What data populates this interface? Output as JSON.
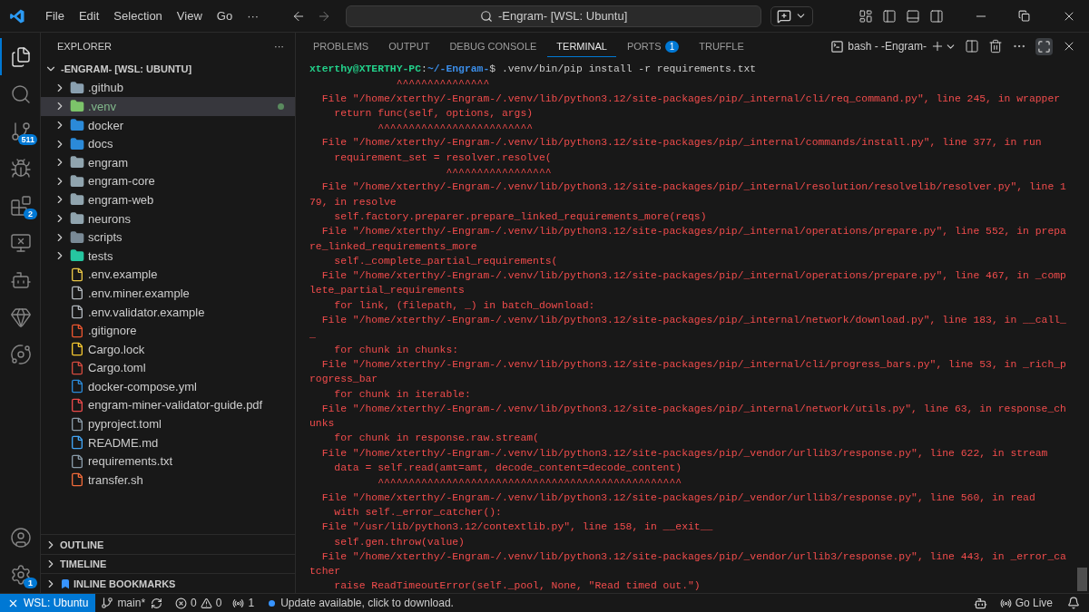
{
  "menu": [
    "File",
    "Edit",
    "Selection",
    "View",
    "Go",
    "···"
  ],
  "command_center": {
    "text": "-Engram- [WSL: Ubuntu]"
  },
  "activity_bar": {
    "badges": [
      "511",
      "2",
      "1"
    ]
  },
  "explorer": {
    "title": "EXPLORER",
    "more": "···",
    "root": "-ENGRAM- [WSL: UBUNTU]",
    "items": [
      {
        "label": ".github",
        "kind": "folder",
        "color": "#8aa0b0",
        "selected": false,
        "ignored": false
      },
      {
        "label": ".venv",
        "kind": "folder",
        "color": "#7cc46a",
        "selected": true,
        "ignored": true
      },
      {
        "label": "docker",
        "kind": "folder",
        "color": "#2b8ad8",
        "selected": false,
        "ignored": false
      },
      {
        "label": "docs",
        "kind": "folder",
        "color": "#2b8ad8",
        "selected": false,
        "ignored": false
      },
      {
        "label": "engram",
        "kind": "folder",
        "color": "#90a4ae",
        "selected": false,
        "ignored": false
      },
      {
        "label": "engram-core",
        "kind": "folder",
        "color": "#90a4ae",
        "selected": false,
        "ignored": false
      },
      {
        "label": "engram-web",
        "kind": "folder",
        "color": "#90a4ae",
        "selected": false,
        "ignored": false
      },
      {
        "label": "neurons",
        "kind": "folder",
        "color": "#90a4ae",
        "selected": false,
        "ignored": false
      },
      {
        "label": "scripts",
        "kind": "folder",
        "color": "#7a8a96",
        "selected": false,
        "ignored": false
      },
      {
        "label": "tests",
        "kind": "folder",
        "color": "#26c6a0",
        "selected": false,
        "ignored": false
      },
      {
        "label": ".env.example",
        "kind": "file",
        "color": "#e8c547",
        "selected": false,
        "ignored": false
      },
      {
        "label": ".env.miner.example",
        "kind": "file",
        "color": "#b0b6bc",
        "selected": false,
        "ignored": false
      },
      {
        "label": ".env.validator.example",
        "kind": "file",
        "color": "#b0b6bc",
        "selected": false,
        "ignored": false
      },
      {
        "label": ".gitignore",
        "kind": "file",
        "color": "#e8552f",
        "selected": false,
        "ignored": false
      },
      {
        "label": "Cargo.lock",
        "kind": "file",
        "color": "#f2c530",
        "selected": false,
        "ignored": false
      },
      {
        "label": "Cargo.toml",
        "kind": "file",
        "color": "#d24a3e",
        "selected": false,
        "ignored": false
      },
      {
        "label": "docker-compose.yml",
        "kind": "file",
        "color": "#2b8ad8",
        "selected": false,
        "ignored": false
      },
      {
        "label": "engram-miner-validator-guide.pdf",
        "kind": "file",
        "color": "#e84a4a",
        "selected": false,
        "ignored": false
      },
      {
        "label": "pyproject.toml",
        "kind": "file",
        "color": "#8a9ba8",
        "selected": false,
        "ignored": false
      },
      {
        "label": "README.md",
        "kind": "file",
        "color": "#42a5f5",
        "selected": false,
        "ignored": false
      },
      {
        "label": "requirements.txt",
        "kind": "file",
        "color": "#8a9ba8",
        "selected": false,
        "ignored": false
      },
      {
        "label": "transfer.sh",
        "kind": "file",
        "color": "#ee6a3a",
        "selected": false,
        "ignored": false
      }
    ],
    "sections": [
      "OUTLINE",
      "TIMELINE",
      "INLINE BOOKMARKS"
    ]
  },
  "panel": {
    "tabs": [
      {
        "label": "PROBLEMS",
        "selected": false
      },
      {
        "label": "OUTPUT",
        "selected": false
      },
      {
        "label": "DEBUG CONSOLE",
        "selected": false
      },
      {
        "label": "TERMINAL",
        "selected": true
      },
      {
        "label": "PORTS",
        "selected": false,
        "badge": "1"
      },
      {
        "label": "TRUFFLE",
        "selected": false
      }
    ],
    "terminal_name": "bash - -Engram-"
  },
  "terminal": {
    "prompt": {
      "user": "xterthy@XTERTHY-PC",
      "sep": ":",
      "path": "~/-Engram-",
      "symbol": "$",
      "command": " .venv/bin/pip install -r requirements.txt"
    },
    "lines": [
      "              ^^^^^^^^^^^^^^^",
      "  File \"/home/xterthy/-Engram-/.venv/lib/python3.12/site-packages/pip/_internal/cli/req_command.py\", line 245, in wrapper",
      "    return func(self, options, args)",
      "           ^^^^^^^^^^^^^^^^^^^^^^^^^",
      "  File \"/home/xterthy/-Engram-/.venv/lib/python3.12/site-packages/pip/_internal/commands/install.py\", line 377, in run",
      "    requirement_set = resolver.resolve(",
      "                      ^^^^^^^^^^^^^^^^^",
      "  File \"/home/xterthy/-Engram-/.venv/lib/python3.12/site-packages/pip/_internal/resolution/resolvelib/resolver.py\", line 1",
      "79, in resolve",
      "    self.factory.preparer.prepare_linked_requirements_more(reqs)",
      "  File \"/home/xterthy/-Engram-/.venv/lib/python3.12/site-packages/pip/_internal/operations/prepare.py\", line 552, in prepa",
      "re_linked_requirements_more",
      "    self._complete_partial_requirements(",
      "  File \"/home/xterthy/-Engram-/.venv/lib/python3.12/site-packages/pip/_internal/operations/prepare.py\", line 467, in _comp",
      "lete_partial_requirements",
      "    for link, (filepath, _) in batch_download:",
      "  File \"/home/xterthy/-Engram-/.venv/lib/python3.12/site-packages/pip/_internal/network/download.py\", line 183, in __call_",
      "_",
      "    for chunk in chunks:",
      "  File \"/home/xterthy/-Engram-/.venv/lib/python3.12/site-packages/pip/_internal/cli/progress_bars.py\", line 53, in _rich_p",
      "rogress_bar",
      "    for chunk in iterable:",
      "  File \"/home/xterthy/-Engram-/.venv/lib/python3.12/site-packages/pip/_internal/network/utils.py\", line 63, in response_ch",
      "unks",
      "    for chunk in response.raw.stream(",
      "  File \"/home/xterthy/-Engram-/.venv/lib/python3.12/site-packages/pip/_vendor/urllib3/response.py\", line 622, in stream",
      "    data = self.read(amt=amt, decode_content=decode_content)",
      "           ^^^^^^^^^^^^^^^^^^^^^^^^^^^^^^^^^^^^^^^^^^^^^^^^^",
      "  File \"/home/xterthy/-Engram-/.venv/lib/python3.12/site-packages/pip/_vendor/urllib3/response.py\", line 560, in read",
      "    with self._error_catcher():",
      "  File \"/usr/lib/python3.12/contextlib.py\", line 158, in __exit__",
      "    self.gen.throw(value)",
      "  File \"/home/xterthy/-Engram-/.venv/lib/python3.12/site-packages/pip/_vendor/urllib3/response.py\", line 443, in _error_ca",
      "tcher",
      "    raise ReadTimeoutError(self._pool, None, \"Read timed out.\")"
    ]
  },
  "status_bar": {
    "remote": "WSL: Ubuntu",
    "branch": "main*",
    "errors": "0",
    "warnings": "0",
    "ports": "1",
    "update": "Update available, click to download.",
    "go_live": "Go Live"
  }
}
